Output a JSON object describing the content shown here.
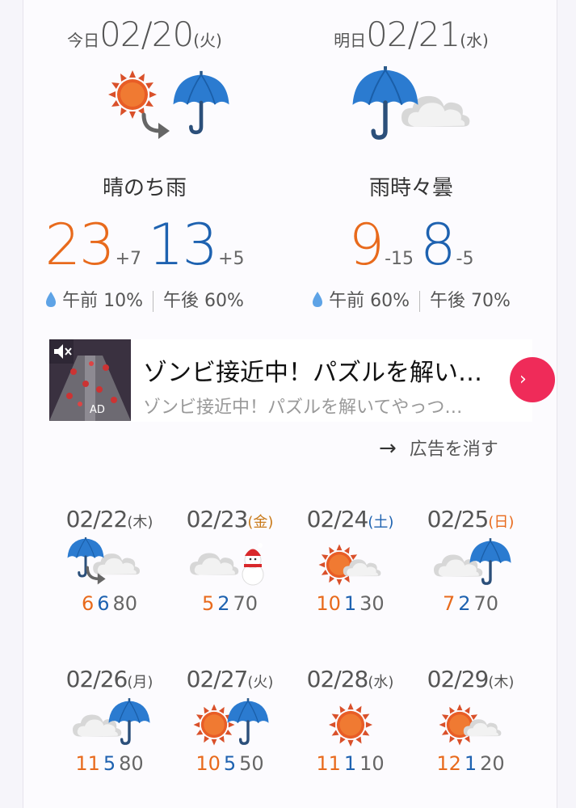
{
  "today": {
    "prefix": "今日",
    "date": "02/20",
    "dow": "(火)",
    "condition": "晴のち雨",
    "high": "23",
    "high_diff": "+7",
    "low": "13",
    "low_diff": "+5",
    "rain_am": "午前 10%",
    "rain_pm": "午後 60%",
    "icon": "sun-then-rain-icon"
  },
  "tomorrow": {
    "prefix": "明日",
    "date": "02/21",
    "dow": "(水)",
    "condition": "雨時々曇",
    "high": "9",
    "high_diff": "-15",
    "low": "8",
    "low_diff": "-5",
    "rain_am": "午前 60%",
    "rain_pm": "午後 70%",
    "icon": "rain-sometimes-cloud-icon"
  },
  "ad": {
    "badge": "AD",
    "title": "ゾンビ接近中！パズルを解い…",
    "subtitle": "ゾンビ接近中！パズルを解いてやっつ…",
    "remove_label": "広告を消す"
  },
  "days": [
    {
      "date": "02/22",
      "dow": "(木)",
      "dow_color": "#555555",
      "high": "6",
      "low": "6",
      "pop": "80",
      "icon": "rain-then-cloud-icon"
    },
    {
      "date": "02/23",
      "dow": "(金)",
      "dow_color": "#c97a1a",
      "high": "5",
      "low": "2",
      "pop": "70",
      "icon": "cloud-snow-icon"
    },
    {
      "date": "02/24",
      "dow": "(土)",
      "dow_color": "#1e62b0",
      "high": "10",
      "low": "1",
      "pop": "30",
      "icon": "sun-cloud-icon"
    },
    {
      "date": "02/25",
      "dow": "(日)",
      "dow_color": "#e86a1c",
      "high": "7",
      "low": "2",
      "pop": "70",
      "icon": "cloud-rain-icon"
    },
    {
      "date": "02/26",
      "dow": "(月)",
      "dow_color": "#555555",
      "high": "11",
      "low": "5",
      "pop": "80",
      "icon": "cloud-rain-icon"
    },
    {
      "date": "02/27",
      "dow": "(火)",
      "dow_color": "#555555",
      "high": "10",
      "low": "5",
      "pop": "50",
      "icon": "sun-rain-icon"
    },
    {
      "date": "02/28",
      "dow": "(水)",
      "dow_color": "#555555",
      "high": "11",
      "low": "1",
      "pop": "10",
      "icon": "sun-icon"
    },
    {
      "date": "02/29",
      "dow": "(木)",
      "dow_color": "#555555",
      "high": "12",
      "low": "1",
      "pop": "20",
      "icon": "sun-cloud-icon"
    }
  ]
}
